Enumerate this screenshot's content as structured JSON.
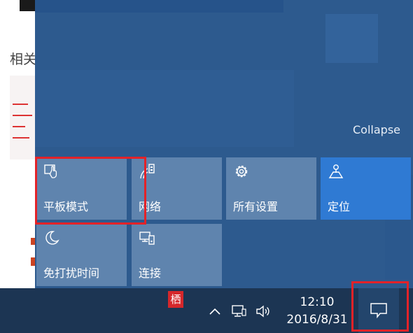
{
  "background_page": {
    "heading": "相关"
  },
  "action_center": {
    "collapse_label": "Collapse",
    "tiles": [
      {
        "label": "平板模式",
        "icon": "tablet-mode-icon",
        "active": false
      },
      {
        "label": "网络",
        "icon": "network-icon",
        "active": false
      },
      {
        "label": "所有设置",
        "icon": "gear-icon",
        "active": false
      },
      {
        "label": "定位",
        "icon": "location-icon",
        "active": true
      },
      {
        "label": "免打扰时间",
        "icon": "moon-icon",
        "active": false
      },
      {
        "label": "连接",
        "icon": "connect-icon",
        "active": false
      }
    ],
    "colors": {
      "panel": "#2d5a8e",
      "tile": "#5f84ae",
      "tile_active": "#2f7ad3"
    }
  },
  "taskbar": {
    "app_icon_glyph": "栖",
    "tray_icons": [
      "chevron-up-icon",
      "network-monitor-icon",
      "speaker-icon"
    ],
    "time": "12:10",
    "date": "2016/8/31",
    "notification_icon": "notification-icon",
    "colors": {
      "bar": "#1c3553",
      "notify_button": "#23456c"
    }
  },
  "highlight_color": "#e32228"
}
